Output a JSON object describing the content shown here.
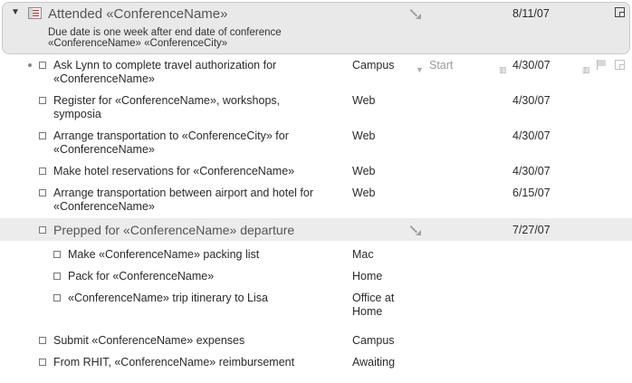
{
  "project": {
    "title": "Attended «ConferenceName»",
    "date": "8/11/07",
    "note_line1": "Due date is one week after end date of conference",
    "note_line2": "«ConferenceName» «ConferenceCity»"
  },
  "tasks": [
    {
      "line1": "Ask Lynn to complete travel authorization for",
      "line2": "«ConferenceName»",
      "context": "Campus",
      "start": "Start",
      "date": "4/30/07"
    },
    {
      "line1": "Register for «ConferenceName», workshops,",
      "line2": "symposia",
      "context": "Web",
      "date": "4/30/07"
    },
    {
      "line1": "Arrange transportation to «ConferenceCity» for",
      "line2": "«ConferenceName»",
      "context": "Web",
      "date": "4/30/07"
    },
    {
      "line1": "Make hotel reservations for «ConferenceName»",
      "context": "Web",
      "date": "4/30/07"
    },
    {
      "line1": "Arrange transportation between airport and hotel for",
      "line2": "«ConferenceName»",
      "context": "Web",
      "date": "6/15/07"
    }
  ],
  "group": {
    "title": "Prepped for «ConferenceName» departure",
    "date": "7/27/07"
  },
  "subtasks": [
    {
      "text": "Make «ConferenceName» packing list",
      "context": "Mac"
    },
    {
      "text": "Pack for «ConferenceName»",
      "context": "Home"
    },
    {
      "text": "«ConferenceName» trip itinerary to Lisa",
      "context1": "Office at",
      "context2": "Home"
    }
  ],
  "tail_tasks": [
    {
      "text": "Submit «ConferenceName» expenses",
      "context": "Campus"
    },
    {
      "text": "From RHIT, «ConferenceName» reimbursement",
      "context": "Awaiting"
    }
  ]
}
